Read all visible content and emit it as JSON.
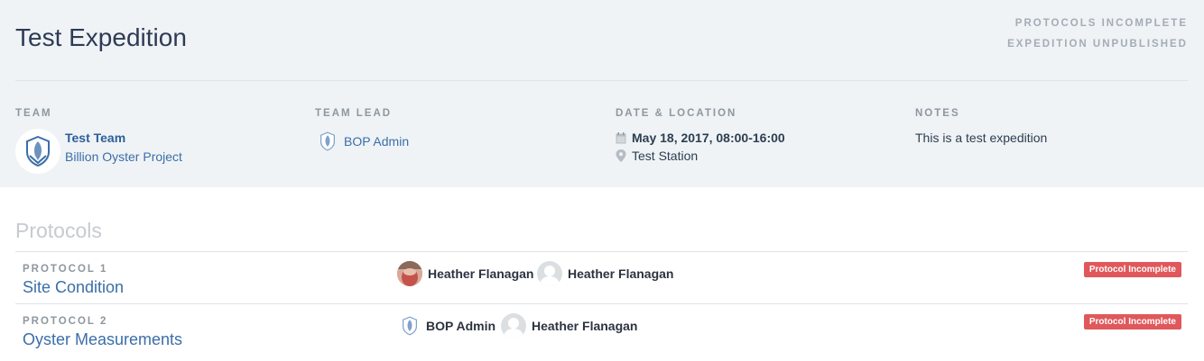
{
  "expedition": {
    "title": "Test Expedition",
    "status_protocols": "PROTOCOLS INCOMPLETE",
    "status_expedition": "EXPEDITION UNPUBLISHED"
  },
  "details": {
    "team": {
      "label": "TEAM",
      "name": "Test Team",
      "org": "Billion Oyster Project",
      "logo_icon": "bop-shield-icon"
    },
    "team_lead": {
      "label": "TEAM LEAD",
      "name": "BOP Admin",
      "icon": "bop-shield-icon"
    },
    "date_location": {
      "label": "DATE & LOCATION",
      "date": "May 18, 2017, 08:00-16:00",
      "location": "Test Station",
      "date_icon": "calendar-icon",
      "location_icon": "map-pin-icon"
    },
    "notes": {
      "label": "NOTES",
      "text": "This is a test expedition"
    }
  },
  "protocols": {
    "title": "Protocols",
    "items": [
      {
        "label": "PROTOCOL 1",
        "name": "Site Condition",
        "members": [
          {
            "name": "Heather Flanagan",
            "avatar": "photo"
          },
          {
            "name": "Heather Flanagan",
            "avatar": "default-user-icon"
          }
        ],
        "status": "Protocol Incomplete"
      },
      {
        "label": "PROTOCOL 2",
        "name": "Oyster Measurements",
        "members": [
          {
            "name": "BOP Admin",
            "avatar": "bop-shield-icon"
          },
          {
            "name": "Heather Flanagan",
            "avatar": "default-user-icon"
          }
        ],
        "status": "Protocol Incomplete"
      }
    ]
  },
  "colors": {
    "header_bg": "#eff3f6",
    "link": "#3b6ea8",
    "badge": "#e0585b",
    "muted_label": "#8e979f"
  }
}
